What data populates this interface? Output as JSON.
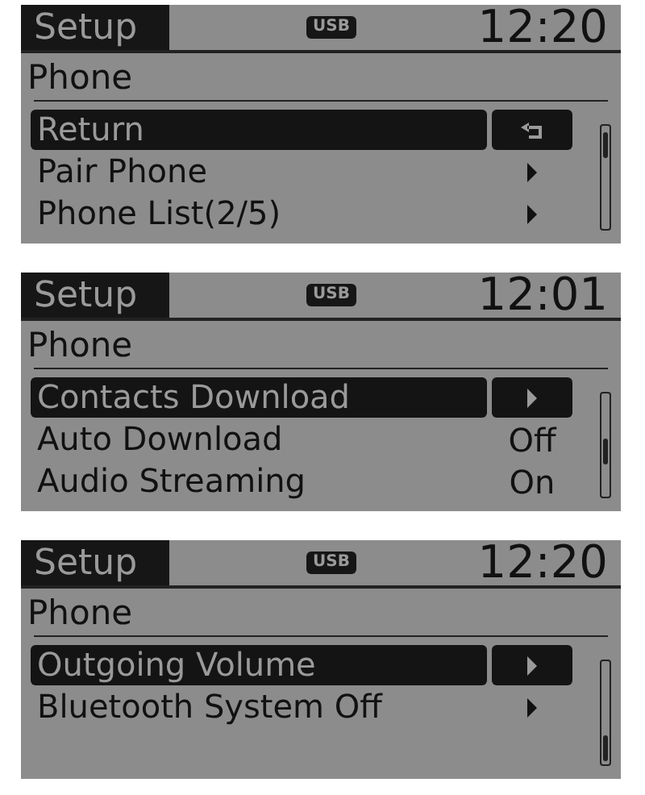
{
  "screens": [
    {
      "title": "Setup",
      "source": "USB",
      "time": "12:20",
      "section": "Phone",
      "rows": [
        {
          "label": "Return",
          "kind": "return",
          "selected": true
        },
        {
          "label": "Pair Phone",
          "kind": "arrow",
          "selected": false
        },
        {
          "label": "Phone List(2/5)",
          "kind": "arrow",
          "selected": false
        }
      ]
    },
    {
      "title": "Setup",
      "source": "USB",
      "time": "12:01",
      "section": "Phone",
      "rows": [
        {
          "label": "Contacts Download",
          "kind": "arrow",
          "selected": true
        },
        {
          "label": "Auto Download",
          "kind": "value",
          "value": "Off",
          "selected": false
        },
        {
          "label": "Audio Streaming",
          "kind": "value",
          "value": "On",
          "selected": false
        }
      ]
    },
    {
      "title": "Setup",
      "source": "USB",
      "time": "12:20",
      "section": "Phone",
      "rows": [
        {
          "label": "Outgoing Volume",
          "kind": "arrow",
          "selected": true
        },
        {
          "label": "Bluetooth System Off",
          "kind": "arrow",
          "selected": false
        }
      ]
    }
  ]
}
